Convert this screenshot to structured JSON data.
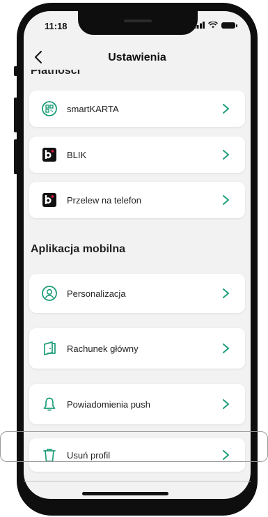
{
  "status_bar": {
    "time": "11:18"
  },
  "header": {
    "back_label": "<",
    "title": "Ustawienia"
  },
  "sections": {
    "payments": {
      "title": "Płatności",
      "items": [
        {
          "label": "smartKARTA",
          "icon": "qr-card-icon"
        },
        {
          "label": "BLIK",
          "icon": "blik-logo-icon"
        },
        {
          "label": "Przelew na telefon",
          "icon": "blik-logo-icon"
        }
      ]
    },
    "mobile_app": {
      "title": "Aplikacja mobilna",
      "items": [
        {
          "label": "Personalizacja",
          "icon": "user-circle-icon"
        },
        {
          "label": "Rachunek główny",
          "icon": "document-icon"
        },
        {
          "label": "Powiadomienia push",
          "icon": "bell-icon"
        },
        {
          "label": "Usuń profil",
          "icon": "trash-icon"
        }
      ]
    }
  },
  "colors": {
    "accent": "#1f9e7a",
    "background": "#f2f2f2",
    "card": "#ffffff",
    "text": "#222222"
  }
}
